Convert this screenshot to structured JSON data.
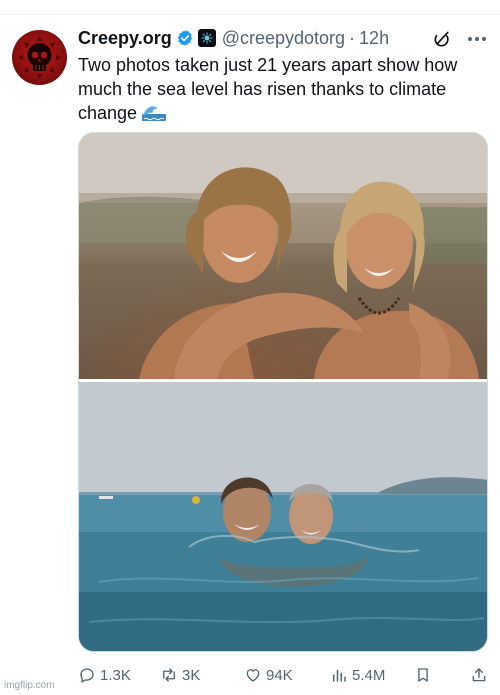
{
  "tweet": {
    "display_name": "Creepy.org",
    "handle": "@creepydotorg",
    "separator": "·",
    "time": "12h",
    "text": "Two photos taken just 21 years apart show how much the sea level has risen thanks to climate change",
    "emoji_icon": "water-wave-icon"
  },
  "media": {
    "photo_count": 2
  },
  "actions": {
    "replies": "1.3K",
    "reposts": "3K",
    "likes": "94K",
    "views": "5.4M"
  },
  "watermark": "imgflip.com",
  "colors": {
    "verified": "#1d9bf0",
    "avatar": "#b51b1b",
    "text": "#0f1419",
    "muted": "#536471"
  }
}
